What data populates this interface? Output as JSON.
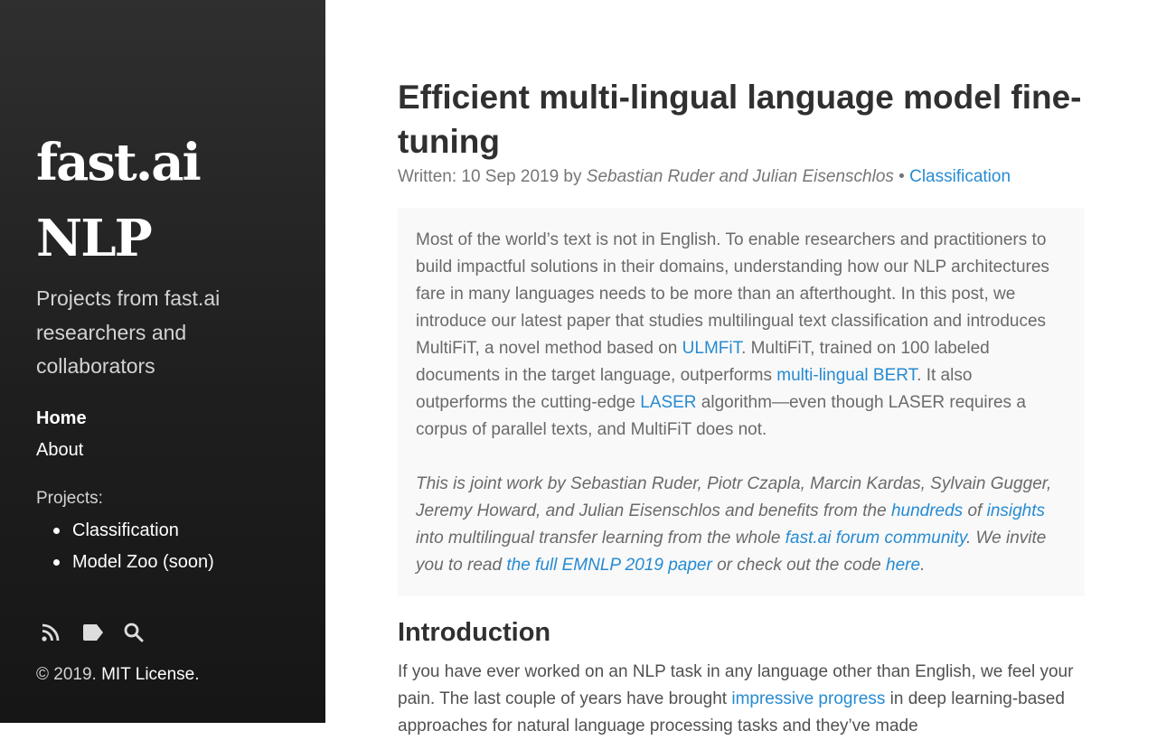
{
  "sidebar": {
    "title_line1": "fast.ai",
    "title_line2": "NLP",
    "tagline": "Projects from fast.ai researchers and collaborators",
    "nav": [
      {
        "label": "Home",
        "active": true
      },
      {
        "label": "About",
        "active": false
      }
    ],
    "projects_label": "Projects:",
    "projects": [
      "Classification",
      "Model Zoo (soon)"
    ],
    "icons": [
      "rss-icon",
      "tag-icon",
      "search-icon"
    ],
    "footer_prefix": "© 2019.",
    "footer_link": "MIT License."
  },
  "post": {
    "title": "Efficient multi-lingual language model fine-tuning",
    "meta_prefix": "Written: 10 Sep 2019 by",
    "meta_authors": "Sebastian Ruder and Julian Eisenschlos",
    "meta_sep": "•",
    "meta_category": "Classification",
    "summary": {
      "p1_a": "Most of the world’s text is not in English. To enable researchers and practitioners to build impactful solutions in their domains, understanding how our NLP architectures fare in many languages needs to be more than an afterthought. In this post, we introduce our latest paper that studies multilingual text classification and introduces MultiFiT, a novel method based on",
      "p1_link1": "ULMFiT",
      "p1_b": ". MultiFiT, trained on 100 labeled documents in the target language, outperforms",
      "p1_link2": "multi-lingual BERT",
      "p1_c": ". It also outperforms the cutting-edge",
      "p1_link3": "LASER",
      "p1_d": "algorithm—even though LASER requires a corpus of parallel texts, and MultiFiT does not.",
      "p2_a": "This is joint work by Sebastian Ruder, Piotr Czapla, Marcin Kardas, Sylvain Gugger, Jeremy Howard, and Julian Eisenschlos and benefits from the",
      "p2_link1": "hundreds",
      "p2_b": "of",
      "p2_link2": "insights",
      "p2_c": "into multilingual transfer learning from the whole",
      "p2_link3": "fast.ai forum community",
      "p2_d": ". We invite you to read",
      "p2_link4": "the full EMNLP 2019 paper",
      "p2_e": "or check out the code",
      "p2_link5": "here",
      "p2_f": "."
    },
    "section_title": "Introduction",
    "intro_a": "If you have ever worked on an NLP task in any language other than English, we feel your pain. The last couple of years have brought",
    "intro_link": "impressive progress",
    "intro_b": "in deep learning-based approaches for natural language processing tasks and they’ve made"
  },
  "colors": {
    "link": "#268bd2",
    "sidebar_bg": "#202020",
    "summary_bg": "#f9f9f9"
  }
}
